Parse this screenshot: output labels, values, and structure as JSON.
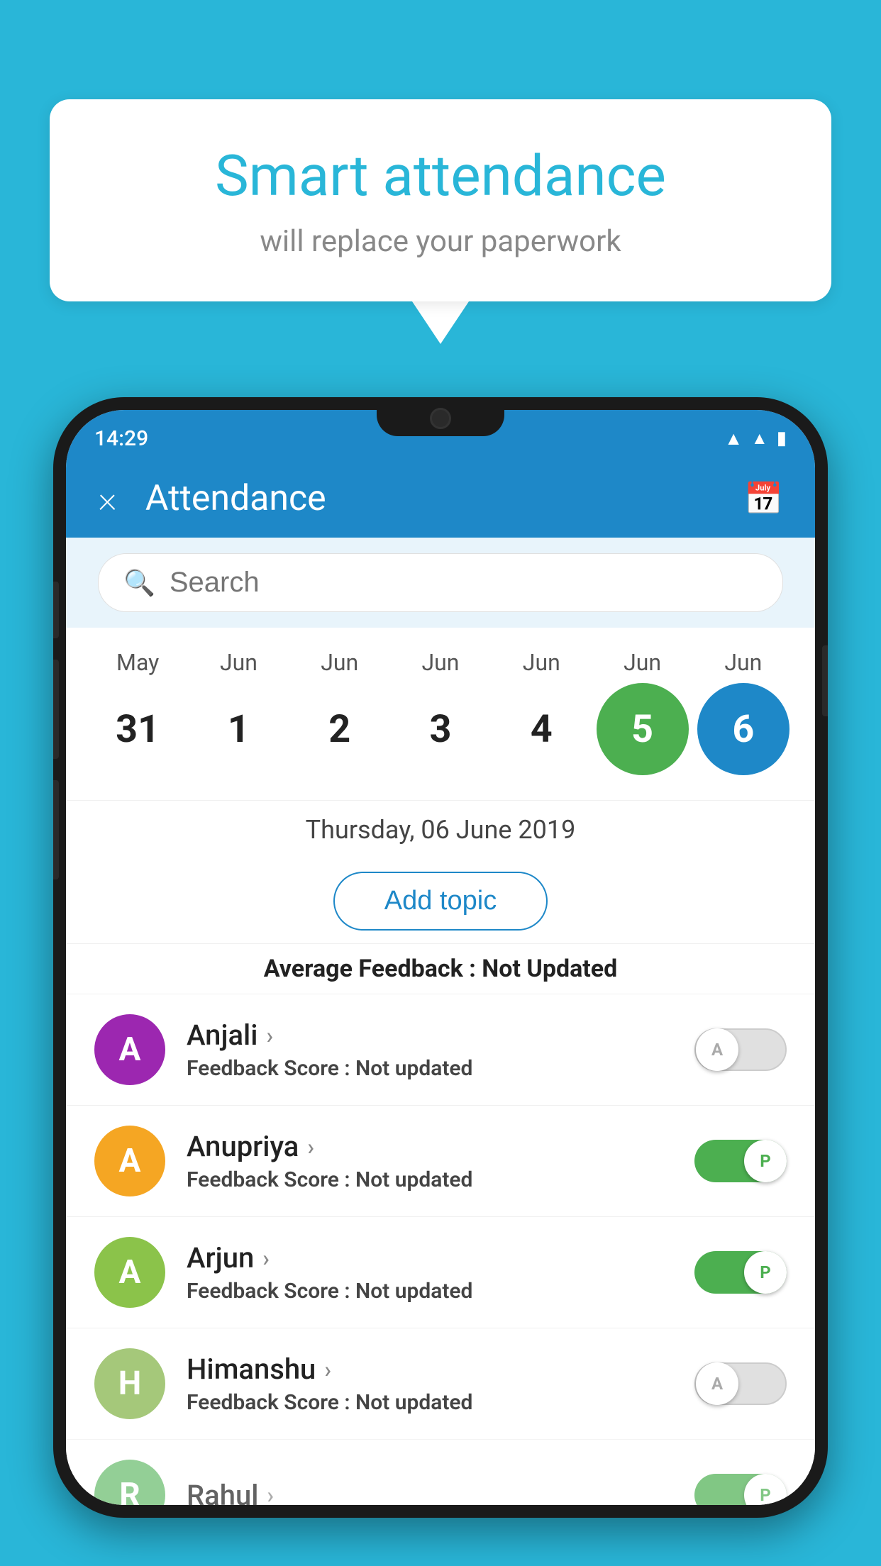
{
  "background": {
    "color": "#29b6d8"
  },
  "speech_bubble": {
    "title": "Smart attendance",
    "subtitle": "will replace your paperwork"
  },
  "status_bar": {
    "time": "14:29",
    "wifi_icon": "wifi",
    "signal_icon": "signal",
    "battery_icon": "battery"
  },
  "app_header": {
    "title": "Attendance",
    "close_icon": "×",
    "calendar_icon": "📅"
  },
  "search": {
    "placeholder": "Search"
  },
  "calendar": {
    "months": [
      "May",
      "Jun",
      "Jun",
      "Jun",
      "Jun",
      "Jun",
      "Jun"
    ],
    "days": [
      "31",
      "1",
      "2",
      "3",
      "4",
      "5",
      "6"
    ],
    "today_index": 5,
    "selected_index": 6
  },
  "selected_date": {
    "display": "Thursday, 06 June 2019"
  },
  "add_topic": {
    "label": "Add topic"
  },
  "average_feedback": {
    "label": "Average Feedback : ",
    "value": "Not Updated"
  },
  "students": [
    {
      "name": "Anjali",
      "avatar_letter": "A",
      "avatar_color": "#9c27b0",
      "feedback_label": "Feedback Score : ",
      "feedback_value": "Not updated",
      "attendance": "absent",
      "toggle_letter": "A"
    },
    {
      "name": "Anupriya",
      "avatar_letter": "A",
      "avatar_color": "#f5a623",
      "feedback_label": "Feedback Score : ",
      "feedback_value": "Not updated",
      "attendance": "present",
      "toggle_letter": "P"
    },
    {
      "name": "Arjun",
      "avatar_letter": "A",
      "avatar_color": "#8bc34a",
      "feedback_label": "Feedback Score : ",
      "feedback_value": "Not updated",
      "attendance": "present",
      "toggle_letter": "P"
    },
    {
      "name": "Himanshu",
      "avatar_letter": "H",
      "avatar_color": "#a5c87a",
      "feedback_label": "Feedback Score : ",
      "feedback_value": "Not updated",
      "attendance": "absent",
      "toggle_letter": "A"
    }
  ]
}
